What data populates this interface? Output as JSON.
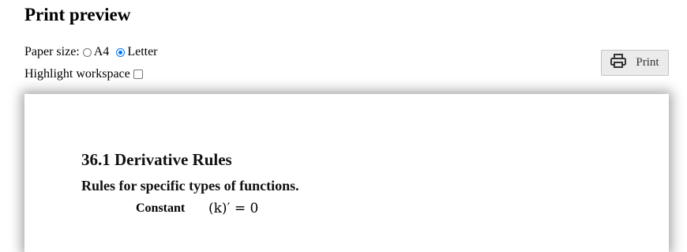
{
  "page": {
    "title": "Print preview"
  },
  "controls": {
    "paper_size_label": "Paper size:",
    "paper_options": [
      {
        "label": "A4",
        "selected": false
      },
      {
        "label": "Letter",
        "selected": true
      }
    ],
    "highlight_label": "Highlight workspace",
    "highlight_checked": false
  },
  "print_button": {
    "label": "Print",
    "icon": "printer-icon"
  },
  "document": {
    "heading": "36.1 Derivative Rules",
    "subheading": "Rules for specific types of functions.",
    "rule": {
      "name": "Constant",
      "formula": "(k)′ = 0"
    }
  }
}
